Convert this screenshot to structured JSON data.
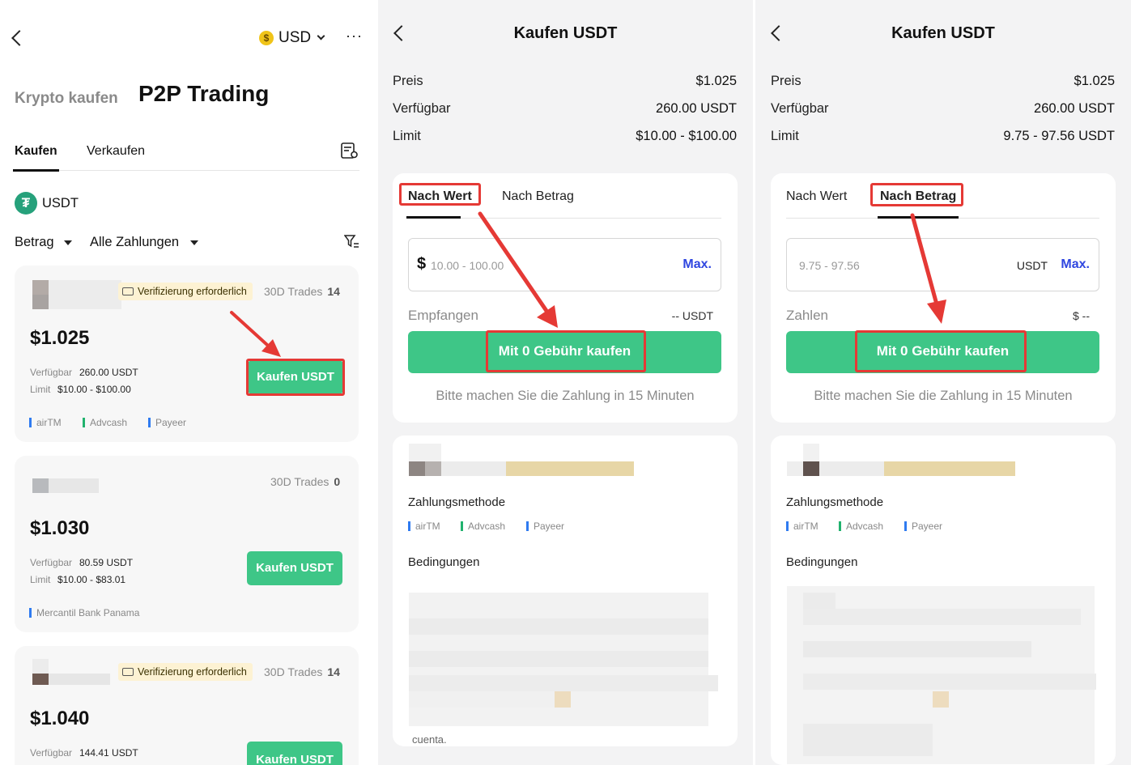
{
  "screen1": {
    "currency": "USD",
    "currency_icon": "$",
    "more": "···",
    "heading_secondary": "Krypto kaufen",
    "heading_primary": "P2P Trading",
    "tabs": [
      "Kaufen",
      "Verkaufen"
    ],
    "asset": "USDT",
    "filters": {
      "amount": "Betrag",
      "payments": "Alle Zahlungen"
    },
    "ads": [
      {
        "verified_badge": "Verifizierung erforderlich",
        "trades_label": "30D Trades",
        "trades_count": "14",
        "price": "$1.025",
        "available_label": "Verfügbar",
        "available_value": "260.00 USDT",
        "limit_label": "Limit",
        "limit_value": "$10.00 - $100.00",
        "payments": [
          "airTM",
          "Advcash",
          "Payeer"
        ],
        "button": "Kaufen USDT"
      },
      {
        "verified_badge": "",
        "trades_label": "30D Trades",
        "trades_count": "0",
        "price": "$1.030",
        "available_label": "Verfügbar",
        "available_value": "80.59 USDT",
        "limit_label": "Limit",
        "limit_value": "$10.00 - $83.01",
        "payments": [
          "Mercantil Bank Panama"
        ],
        "button": "Kaufen USDT"
      },
      {
        "verified_badge": "Verifizierung erforderlich",
        "trades_label": "30D Trades",
        "trades_count": "14",
        "price": "$1.040",
        "available_label": "Verfügbar",
        "available_value": "144.41 USDT",
        "limit_label": "",
        "limit_value": "",
        "payments": [],
        "button": "Kaufen USDT"
      }
    ]
  },
  "screen2": {
    "title": "Kaufen USDT",
    "rows": [
      {
        "label": "Preis",
        "value": "$1.025"
      },
      {
        "label": "Verfügbar",
        "value": "260.00 USDT"
      },
      {
        "label": "Limit",
        "value": "$10.00 - $100.00"
      }
    ],
    "tabs": [
      "Nach Wert",
      "Nach Betrag"
    ],
    "active_tab": "Nach Wert",
    "input_prefix": "$",
    "input_placeholder": "10.00 - 100.00",
    "max": "Max.",
    "receive_label": "Empfangen",
    "receive_value": "-- USDT",
    "buy_button": "Mit 0 Gebühr kaufen",
    "note": "Bitte machen Sie die Zahlung in 15 Minuten",
    "payment_method_label": "Zahlungsmethode",
    "payments": [
      "airTM",
      "Advcash",
      "Payeer"
    ],
    "conditions_label": "Bedingungen",
    "conditions_tail": "cuenta."
  },
  "screen3": {
    "title": "Kaufen USDT",
    "rows": [
      {
        "label": "Preis",
        "value": "$1.025"
      },
      {
        "label": "Verfügbar",
        "value": "260.00 USDT"
      },
      {
        "label": "Limit",
        "value": "9.75 - 97.56 USDT"
      }
    ],
    "tabs": [
      "Nach Wert",
      "Nach Betrag"
    ],
    "active_tab": "Nach Betrag",
    "input_placeholder": "9.75 - 97.56",
    "input_unit": "USDT",
    "max": "Max.",
    "pay_label": "Zahlen",
    "pay_value": "$ --",
    "buy_button": "Mit 0 Gebühr kaufen",
    "note": "Bitte machen Sie die Zahlung in 15 Minuten",
    "payment_method_label": "Zahlungsmethode",
    "payments": [
      "airTM",
      "Advcash",
      "Payeer"
    ],
    "conditions_label": "Bedingungen"
  },
  "colors": {
    "brand_green": "#3ec687",
    "highlight_red": "#e53935",
    "link_blue": "#2f46e0",
    "badge_bg": "#fdf2d3"
  }
}
